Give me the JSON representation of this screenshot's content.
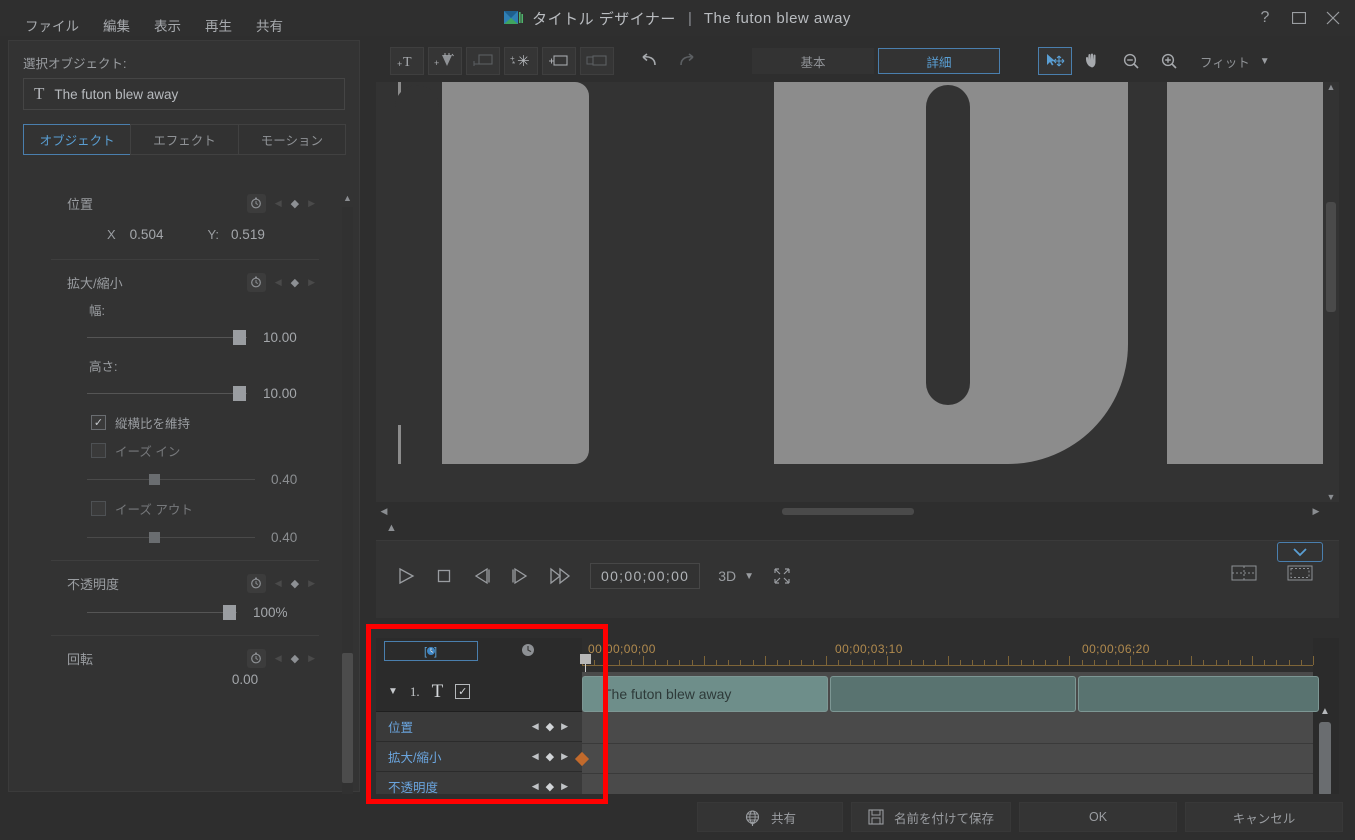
{
  "window": {
    "app_title": "タイトル デザイナー",
    "separator": "|",
    "doc_title": "The futon blew away",
    "help_icon": "?",
    "maximize_icon": "maximize-icon",
    "close_icon": "close-icon"
  },
  "menu": {
    "items": [
      "ファイル",
      "編集",
      "表示",
      "再生",
      "共有"
    ]
  },
  "left_panel": {
    "selected_object_label": "選択オブジェクト:",
    "selected_object_value": "The futon blew away",
    "selected_object_icon": "text-object-icon",
    "tabs": [
      {
        "label": "オブジェクト",
        "active": true
      },
      {
        "label": "エフェクト",
        "active": false
      },
      {
        "label": "モーション",
        "active": false
      }
    ],
    "properties": {
      "position": {
        "label": "位置",
        "x_label": "X",
        "x_value": "0.504",
        "y_label": "Y:",
        "y_value": "0.519"
      },
      "scale": {
        "label": "拡大/縮小",
        "width_label": "幅:",
        "width_value": "10.00",
        "height_label": "高さ:",
        "height_value": "10.00",
        "keep_aspect_label": "縦横比を維持",
        "keep_aspect_checked": true,
        "ease_in_label": "イーズ イン",
        "ease_in_value": "0.40",
        "ease_in_checked": false,
        "ease_out_label": "イーズ アウト",
        "ease_out_value": "0.40",
        "ease_out_checked": false
      },
      "opacity": {
        "label": "不透明度",
        "value": "100%"
      },
      "rotation": {
        "label": "回転",
        "value": "0.00"
      }
    }
  },
  "toolbar": {
    "buttons": [
      {
        "name": "add-text-icon",
        "enabled": true
      },
      {
        "name": "add-graphic-icon",
        "enabled": true
      },
      {
        "name": "add-image-icon",
        "enabled": false
      },
      {
        "name": "add-particle-icon",
        "enabled": true
      },
      {
        "name": "add-frame-icon",
        "enabled": true
      },
      {
        "name": "add-background-icon",
        "enabled": false
      },
      {
        "name": "undo-icon",
        "enabled": true
      },
      {
        "name": "redo-icon",
        "enabled": false
      }
    ],
    "modes": [
      {
        "label": "基本",
        "active": false
      },
      {
        "label": "詳細",
        "active": true
      }
    ],
    "tools": [
      {
        "name": "select-move-icon",
        "selected": true
      },
      {
        "name": "hand-icon",
        "selected": false
      },
      {
        "name": "zoom-out-icon",
        "selected": false
      },
      {
        "name": "zoom-in-icon",
        "selected": false
      }
    ],
    "zoom_label": "フィット",
    "zoom_caret": "▼"
  },
  "transport": {
    "play_icon": "play-icon",
    "stop_icon": "stop-icon",
    "prev_frame_icon": "previous-frame-icon",
    "next_frame_icon": "next-frame-icon",
    "fast_forward_icon": "fast-forward-icon",
    "timecode": "00;00;00;00",
    "mode_3d_label": "3D",
    "mode_3d_caret": "▼",
    "fullscreen_icon": "fullscreen-icon",
    "safe_area_icon": "safe-area-icon",
    "title_safe_icon": "title-safe-icon",
    "expand_icon": "chevron-down-icon"
  },
  "timeline": {
    "keyframe_tab_label": "[🕐]",
    "clock_icon": "clock-icon",
    "ruler_labels": [
      "00;00;00;00",
      "00;00;03;10",
      "00;00;06;20"
    ],
    "object_row": {
      "caret": "▼",
      "number": "1.",
      "type_icon": "text-icon",
      "visible_checked": true
    },
    "param_rows": [
      {
        "label": "位置"
      },
      {
        "label": "拡大/縮小"
      },
      {
        "label": "不透明度"
      }
    ],
    "clips": [
      {
        "label": "The futon blew away",
        "selected": true
      },
      {
        "label": "",
        "selected": false
      },
      {
        "label": "",
        "selected": false
      }
    ],
    "zoom_out_icon": "minus-icon",
    "zoom_in_icon": "plus-icon",
    "collapse_icon": "collapse-left-icon"
  },
  "bottom_bar": {
    "buttons": [
      {
        "label": "共有",
        "icon": "share-globe-icon"
      },
      {
        "label": "名前を付けて保存",
        "icon": "save-icon"
      },
      {
        "label": "OK",
        "icon": ""
      },
      {
        "label": "キャンセル",
        "icon": ""
      }
    ]
  },
  "colors": {
    "accent_blue": "#5a9fd4",
    "highlight_red": "#ff0000",
    "clip_teal": "#6e8e8a",
    "ruler_amber": "#b08a4e"
  }
}
